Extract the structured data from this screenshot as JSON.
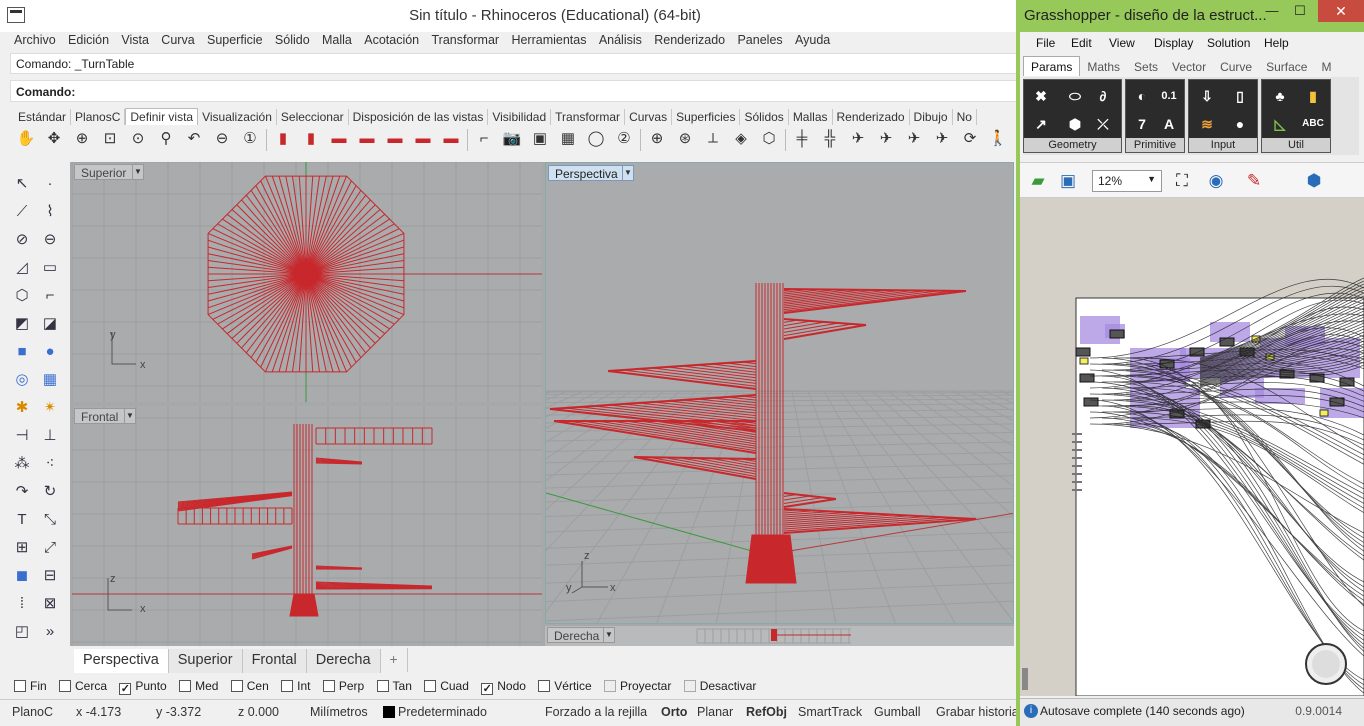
{
  "rhino": {
    "title": "Sin título - Rhinoceros (Educational) (64-bit)",
    "menu": [
      "Archivo",
      "Edición",
      "Vista",
      "Curva",
      "Superficie",
      "Sólido",
      "Malla",
      "Acotación",
      "Transformar",
      "Herramientas",
      "Análisis",
      "Renderizado",
      "Paneles",
      "Ayuda"
    ],
    "command_history": "Comando: _TurnTable",
    "command_prompt": "Comando:",
    "toolbar_tabs": [
      "Estándar",
      "PlanosC",
      "Definir vista",
      "Visualización",
      "Seleccionar",
      "Disposición de las vistas",
      "Visibilidad",
      "Transformar",
      "Curvas",
      "Superficies",
      "Sólidos",
      "Mallas",
      "Renderizado",
      "Dibujo",
      "No"
    ],
    "active_toolbar_tab": "Definir vista",
    "viewports": {
      "top": {
        "label": "Superior",
        "axis_x": "x",
        "axis_y": "y"
      },
      "front": {
        "label": "Frontal",
        "axis_x": "x",
        "axis_y": "z"
      },
      "perspective": {
        "label": "Perspectiva",
        "axis_x": "x",
        "axis_y": "y",
        "axis_z": "z"
      },
      "right": {
        "label": "Derecha"
      }
    },
    "viewport_tabs": [
      "Perspectiva",
      "Superior",
      "Frontal",
      "Derecha"
    ],
    "add_tab": "+",
    "osnaps": [
      {
        "label": "Fin",
        "checked": false
      },
      {
        "label": "Cerca",
        "checked": false
      },
      {
        "label": "Punto",
        "checked": true
      },
      {
        "label": "Med",
        "checked": false
      },
      {
        "label": "Cen",
        "checked": false
      },
      {
        "label": "Int",
        "checked": false
      },
      {
        "label": "Perp",
        "checked": false
      },
      {
        "label": "Tan",
        "checked": false
      },
      {
        "label": "Cuad",
        "checked": false
      },
      {
        "label": "Nodo",
        "checked": true
      },
      {
        "label": "Vértice",
        "checked": false
      },
      {
        "label": "Proyectar",
        "checked": false
      },
      {
        "label": "Desactivar",
        "checked": false
      }
    ],
    "status": {
      "cplane": "PlanoC",
      "x": "x -4.173",
      "y": "y -3.372",
      "z": "z 0.000",
      "units": "Milímetros",
      "layer": "Predeterminado",
      "grid_snap": "Forzado a la rejilla",
      "ortho": "Orto",
      "planar": "Planar",
      "osnap": "RefObj",
      "smarttrack": "SmartTrack",
      "gumball": "Gumball",
      "record_history": "Grabar historia"
    },
    "colors": {
      "geometry": "#c8282c",
      "viewport_bg": "#a9abad",
      "grid": "#9c9ea0",
      "x_axis": "#b43a3a",
      "y_axis": "#3a9a3a"
    }
  },
  "grasshopper": {
    "title": "Grasshopper - diseño de la estruct...",
    "menu": [
      "File",
      "Edit",
      "View",
      "Display",
      "Solution",
      "Help"
    ],
    "tabs": [
      "Params",
      "Maths",
      "Sets",
      "Vector",
      "Curve",
      "Surface",
      "M"
    ],
    "active_tab": "Params",
    "groups": [
      "Geometry",
      "Primitive",
      "Input",
      "Util"
    ],
    "zoom": "12%",
    "status_message": "Autosave complete (140 seconds ago)",
    "version": "0.9.0014",
    "colors": {
      "accent": "#96c85a",
      "canvas": "#d4d0c8",
      "group": "#a78be0"
    }
  }
}
